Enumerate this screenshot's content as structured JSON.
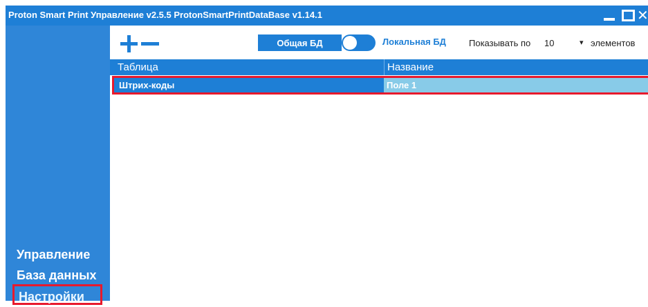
{
  "window": {
    "title": "Proton Smart Print Управление v2.5.5 ProtonSmartPrintDataBase v1.14.1",
    "close_glyph": "✕"
  },
  "sidebar": {
    "items": [
      {
        "label": "Управление",
        "active": false
      },
      {
        "label": "База данных",
        "active": false
      },
      {
        "label": "Настройки",
        "active": true
      }
    ]
  },
  "toolbar": {
    "add_icon": "plus-icon",
    "remove_icon": "minus-icon",
    "shared_db_label": "Общая БД",
    "local_db_label": "Локальная БД",
    "show_label": "Показывать по",
    "page_size": "10",
    "dropdown_glyph": "▾",
    "items_label": "элементов"
  },
  "table": {
    "columns": [
      "Таблица",
      "Название"
    ],
    "rows": [
      [
        "Штрих-коды",
        "Поле 1"
      ]
    ]
  },
  "colors": {
    "accent": "#1e7fd6",
    "sidebar": "#2f86d8",
    "highlight_border": "#e8192c",
    "selected_cell": "#88cbe8"
  }
}
